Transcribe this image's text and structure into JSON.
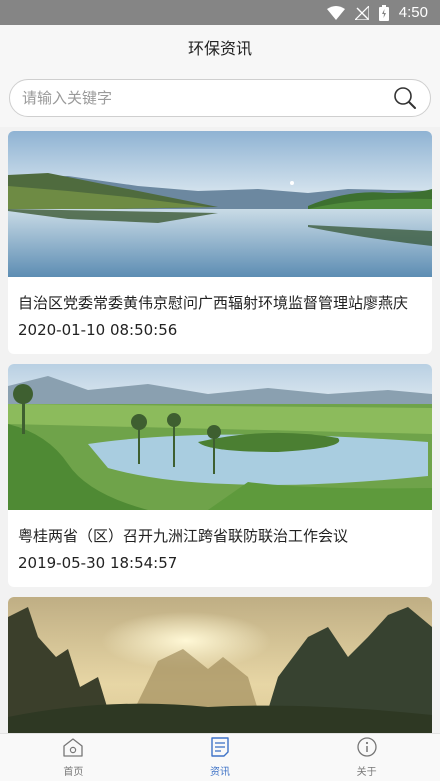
{
  "status_bar": {
    "time": "4:50"
  },
  "header": {
    "title": "环保资讯"
  },
  "search": {
    "placeholder": "请输入关键字"
  },
  "news": [
    {
      "title": "自治区党委常委黄伟京慰问广西辐射环境监督管理站廖燕庆",
      "date": "2020-01-10 08:50:56"
    },
    {
      "title": "粤桂两省（区）召开九洲江跨省联防联治工作会议",
      "date": "2019-05-30 18:54:57"
    },
    {
      "title": "",
      "date": ""
    }
  ],
  "tabbar": {
    "items": [
      {
        "label": "首页",
        "icon": "home-icon",
        "active": false
      },
      {
        "label": "资讯",
        "icon": "news-icon",
        "active": true
      },
      {
        "label": "关于",
        "icon": "info-icon",
        "active": false
      }
    ]
  },
  "colors": {
    "accent": "#3f73c7",
    "status_bar": "#858585"
  }
}
